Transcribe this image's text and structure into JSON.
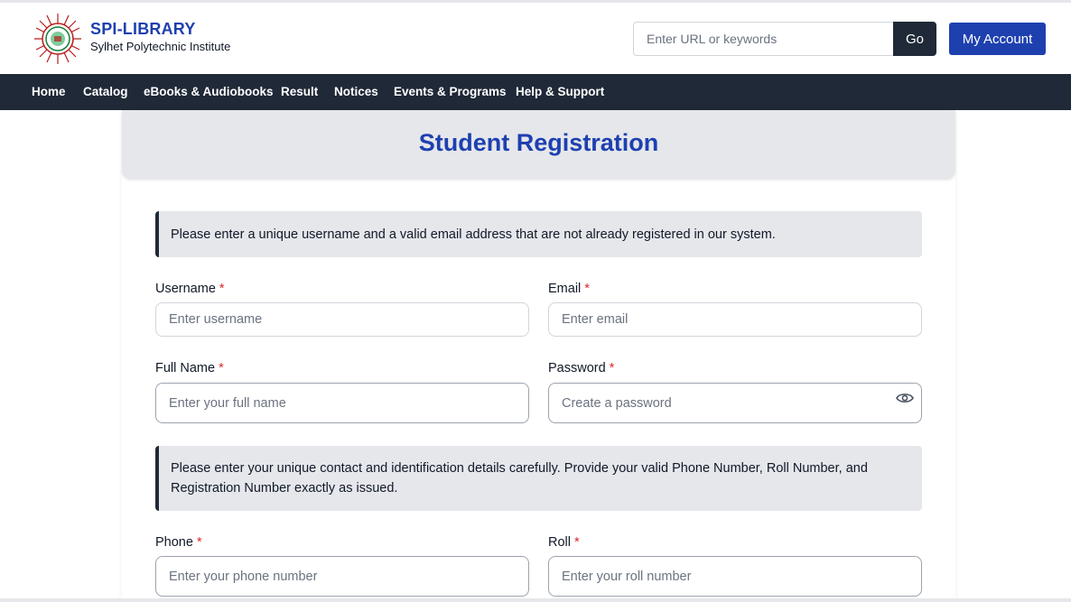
{
  "header": {
    "brand_title": "SPI-LIBRARY",
    "brand_subtitle": "Sylhet Polytechnic Institute",
    "search_placeholder": "Enter URL or keywords",
    "go_label": "Go",
    "account_label": "My Account",
    "logo_icon": "institute-seal-icon"
  },
  "nav": {
    "items": [
      {
        "label": "Home"
      },
      {
        "label": "Catalog"
      },
      {
        "label": "eBooks & Audiobooks"
      },
      {
        "label": "Result"
      },
      {
        "label": "Notices"
      },
      {
        "label": "Events & Programs"
      },
      {
        "label": "Help & Support"
      }
    ]
  },
  "form": {
    "title": "Student Registration",
    "notice1": "Please enter a unique username and a valid email address that are not already registered in our system.",
    "notice2": "Please enter your unique contact and identification details carefully. Provide your valid Phone Number, Roll Number, and Registration Number exactly as issued.",
    "required_mark": "*",
    "username": {
      "label": "Username",
      "placeholder": "Enter username",
      "value": ""
    },
    "email": {
      "label": "Email",
      "placeholder": "Enter email",
      "value": ""
    },
    "full_name": {
      "label": "Full Name",
      "placeholder": "Enter your full name",
      "value": ""
    },
    "password": {
      "label": "Password",
      "placeholder": "Create a password",
      "value": "",
      "toggle_icon": "eye-icon"
    },
    "phone": {
      "label": "Phone",
      "placeholder": "Enter your phone number",
      "value": ""
    },
    "roll": {
      "label": "Roll",
      "placeholder": "Enter your roll number",
      "value": ""
    }
  },
  "colors": {
    "brand_blue": "#1e40af",
    "nav_dark": "#1f2937",
    "required_red": "#dc2626",
    "panel_gray": "#e5e7eb"
  }
}
